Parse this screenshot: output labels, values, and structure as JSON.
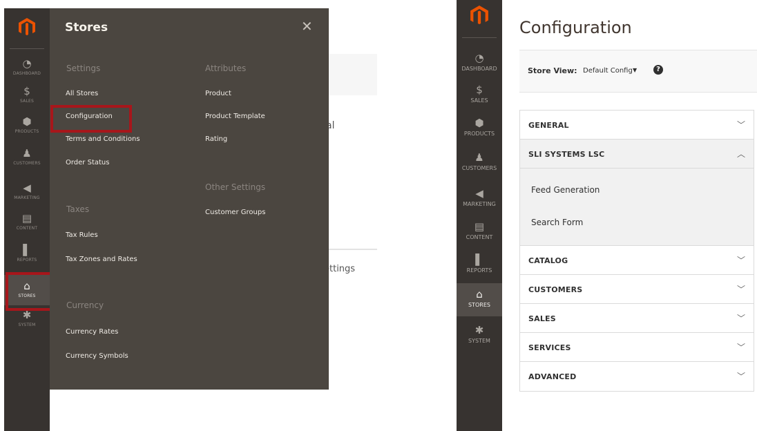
{
  "left": {
    "sidebar": [
      {
        "id": "dashboard",
        "label": "DASHBOARD",
        "icon": "dashboard-icon",
        "glyph": "◔"
      },
      {
        "id": "sales",
        "label": "SALES",
        "icon": "dollar-icon",
        "glyph": "$"
      },
      {
        "id": "products",
        "label": "PRODUCTS",
        "icon": "box-icon",
        "glyph": "⬢"
      },
      {
        "id": "customers",
        "label": "CUSTOMERS",
        "icon": "person-icon",
        "glyph": "♟"
      },
      {
        "id": "marketing",
        "label": "MARKETING",
        "icon": "megaphone-icon",
        "glyph": "◀"
      },
      {
        "id": "content",
        "label": "CONTENT",
        "icon": "layout-icon",
        "glyph": "▤"
      },
      {
        "id": "reports",
        "label": "REPORTS",
        "icon": "bar-chart-icon",
        "glyph": "▌"
      },
      {
        "id": "stores",
        "label": "STORES",
        "icon": "storefront-icon",
        "glyph": "⌂"
      },
      {
        "id": "system",
        "label": "SYSTEM",
        "icon": "gear-icon",
        "glyph": "✱"
      }
    ],
    "flyout": {
      "title": "Stores",
      "close_glyph": "✕",
      "settings": {
        "heading": "Settings",
        "items": [
          "All Stores",
          "Configuration",
          "Terms and Conditions",
          "Order Status"
        ]
      },
      "attributes": {
        "heading": "Attributes",
        "items": [
          "Product",
          "Product Template",
          "Rating"
        ]
      },
      "other": {
        "heading": "Other Settings",
        "items": [
          "Customer Groups"
        ]
      },
      "taxes": {
        "heading": "Taxes",
        "items": [
          "Tax Rules",
          "Tax Zones and Rates"
        ]
      },
      "currency": {
        "heading": "Currency",
        "items": [
          "Currency Rates",
          "Currency Symbols"
        ]
      }
    },
    "bg_text_1": "al",
    "bg_text_2": "ettings"
  },
  "right": {
    "sidebar": [
      {
        "id": "dashboard",
        "label": "DASHBOARD",
        "icon": "dashboard-icon",
        "glyph": "◔"
      },
      {
        "id": "sales",
        "label": "SALES",
        "icon": "dollar-icon",
        "glyph": "$"
      },
      {
        "id": "products",
        "label": "PRODUCTS",
        "icon": "box-icon",
        "glyph": "⬢"
      },
      {
        "id": "customers",
        "label": "CUSTOMERS",
        "icon": "person-icon",
        "glyph": "♟"
      },
      {
        "id": "marketing",
        "label": "MARKETING",
        "icon": "megaphone-icon",
        "glyph": "◀"
      },
      {
        "id": "content",
        "label": "CONTENT",
        "icon": "layout-icon",
        "glyph": "▤"
      },
      {
        "id": "reports",
        "label": "REPORTS",
        "icon": "bar-chart-icon",
        "glyph": "▌"
      },
      {
        "id": "stores",
        "label": "STORES",
        "icon": "storefront-icon",
        "glyph": "⌂"
      },
      {
        "id": "system",
        "label": "SYSTEM",
        "icon": "gear-icon",
        "glyph": "✱"
      }
    ],
    "page_title": "Configuration",
    "store_view": {
      "label": "Store View:",
      "selected": "Default Config",
      "caret": "▼",
      "help": "?"
    },
    "tabs": [
      {
        "label": "GENERAL",
        "expanded": false
      },
      {
        "label": "SLI SYSTEMS LSC",
        "expanded": true,
        "items": [
          "Feed Generation",
          "Search Form"
        ]
      },
      {
        "label": "CATALOG",
        "expanded": false
      },
      {
        "label": "CUSTOMERS",
        "expanded": false
      },
      {
        "label": "SALES",
        "expanded": false
      },
      {
        "label": "SERVICES",
        "expanded": false
      },
      {
        "label": "ADVANCED",
        "expanded": false
      }
    ]
  },
  "colors": {
    "sidebar": "#373330",
    "flyout": "#4b4640",
    "highlight": "#a7161b",
    "logo": "#eb5202"
  }
}
